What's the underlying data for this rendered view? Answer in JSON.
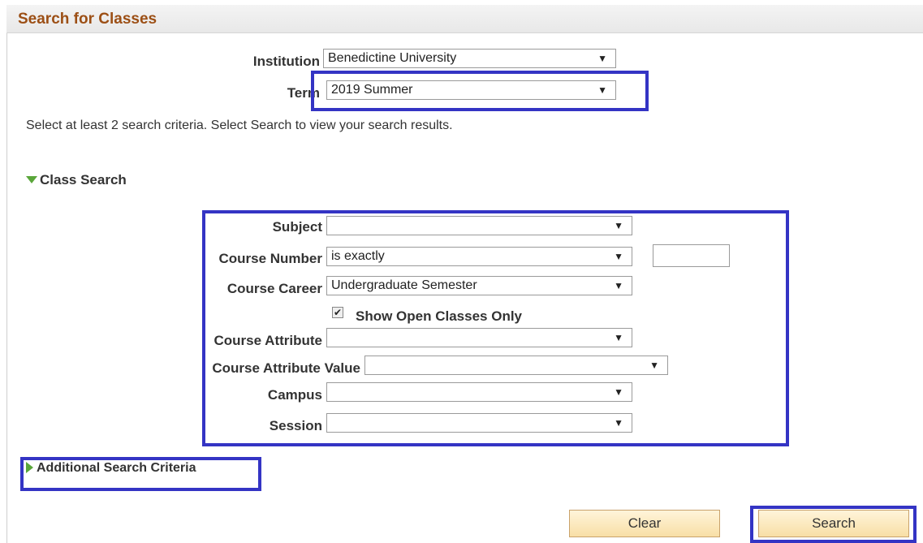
{
  "header": {
    "title": "Search for Classes"
  },
  "institution": {
    "label": "Institution",
    "value": "Benedictine University"
  },
  "term": {
    "label": "Term",
    "value": "2019 Summer"
  },
  "instructions": "Select at least 2 search criteria. Select Search to view your search results.",
  "class_search": {
    "title": "Class Search",
    "subject": {
      "label": "Subject",
      "value": ""
    },
    "course_number": {
      "label": "Course Number",
      "operator": "is exactly",
      "value": ""
    },
    "course_career": {
      "label": "Course Career",
      "value": "Undergraduate Semester"
    },
    "show_open": {
      "label": "Show Open Classes Only",
      "checked": true
    },
    "course_attribute": {
      "label": "Course Attribute",
      "value": ""
    },
    "course_attribute_value": {
      "label": "Course Attribute Value",
      "value": ""
    },
    "campus": {
      "label": "Campus",
      "value": ""
    },
    "session": {
      "label": "Session",
      "value": ""
    }
  },
  "additional": {
    "title": "Additional Search Criteria"
  },
  "buttons": {
    "clear": "Clear",
    "search": "Search"
  },
  "dropdown_arrow": "▼",
  "colors": {
    "highlight": "#3434c4",
    "title": "#9c4f15",
    "triangle": "#5aa63a"
  }
}
